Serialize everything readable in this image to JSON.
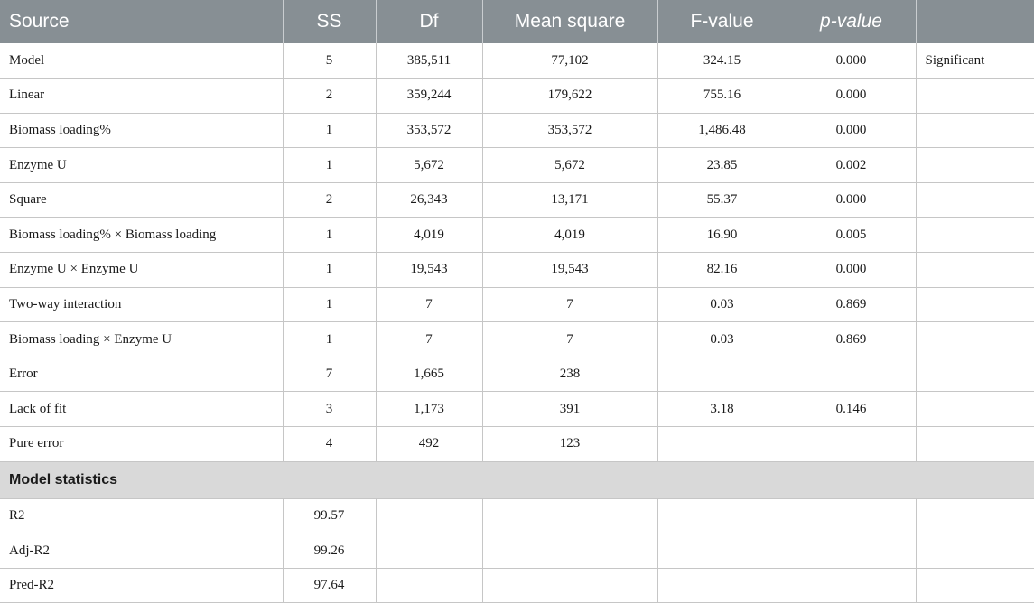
{
  "table": {
    "headers": [
      "Source",
      "SS",
      "Df",
      "Mean square",
      "F-value",
      "p-value",
      ""
    ],
    "rows": [
      [
        "Model",
        "5",
        "385,511",
        "77,102",
        "324.15",
        "0.000",
        "Significant"
      ],
      [
        "Linear",
        "2",
        "359,244",
        "179,622",
        "755.16",
        "0.000",
        ""
      ],
      [
        "Biomass loading%",
        "1",
        "353,572",
        "353,572",
        "1,486.48",
        "0.000",
        ""
      ],
      [
        "Enzyme U",
        "1",
        "5,672",
        "5,672",
        "23.85",
        "0.002",
        ""
      ],
      [
        "Square",
        "2",
        "26,343",
        "13,171",
        "55.37",
        "0.000",
        ""
      ],
      [
        "Biomass loading% × Biomass loading",
        "1",
        "4,019",
        "4,019",
        "16.90",
        "0.005",
        ""
      ],
      [
        "Enzyme U × Enzyme U",
        "1",
        "19,543",
        "19,543",
        "82.16",
        "0.000",
        ""
      ],
      [
        "Two-way interaction",
        "1",
        "7",
        "7",
        "0.03",
        "0.869",
        ""
      ],
      [
        "Biomass loading × Enzyme U",
        "1",
        "7",
        "7",
        "0.03",
        "0.869",
        ""
      ],
      [
        "Error",
        "7",
        "1,665",
        "238",
        "",
        "",
        ""
      ],
      [
        "Lack of fit",
        "3",
        "1,173",
        "391",
        "3.18",
        "0.146",
        ""
      ],
      [
        "Pure error",
        "4",
        "492",
        "123",
        "",
        "",
        ""
      ]
    ],
    "section_label": "Model statistics",
    "stat_rows": [
      [
        "R2",
        "99.57",
        "",
        "",
        "",
        "",
        ""
      ],
      [
        "Adj-R2",
        "99.26",
        "",
        "",
        "",
        "",
        ""
      ],
      [
        "Pred-R2",
        "97.64",
        "",
        "",
        "",
        "",
        ""
      ]
    ]
  },
  "colors": {
    "header_bg": "#878f94",
    "section_bg": "#d9d9d9"
  }
}
